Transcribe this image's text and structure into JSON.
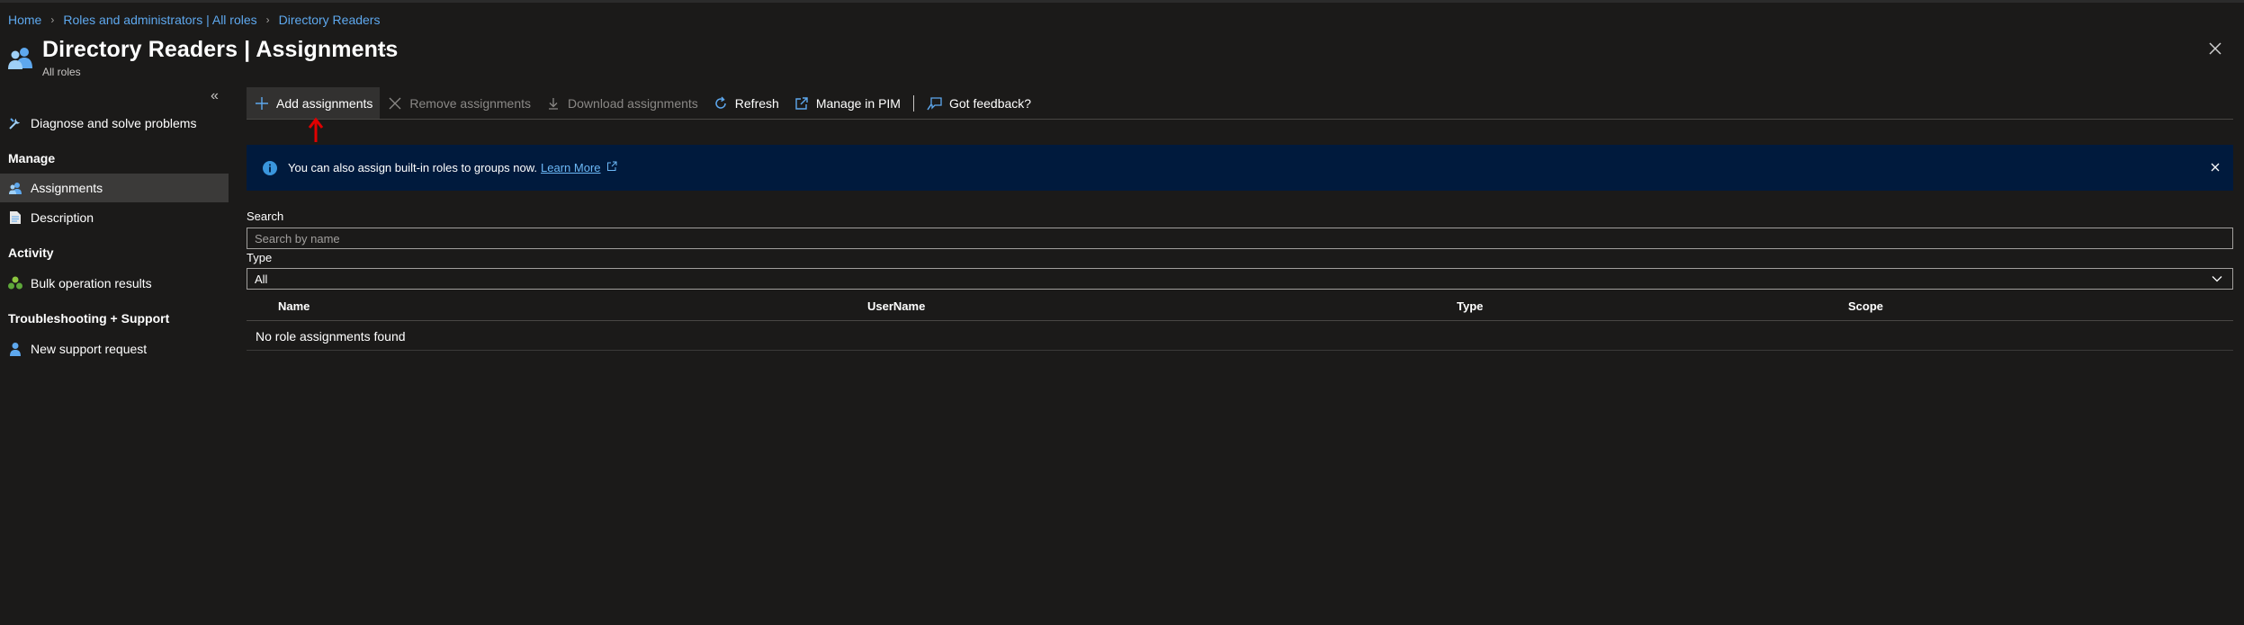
{
  "breadcrumb": [
    {
      "label": "Home"
    },
    {
      "label": "Roles and administrators | All roles"
    },
    {
      "label": "Directory Readers"
    }
  ],
  "header": {
    "title": "Directory Readers | Assignments",
    "subtitle": "All roles",
    "more_label": "···",
    "icon": "users-icon"
  },
  "sidebar": {
    "collapse_label": "«",
    "items": [
      {
        "label": "Diagnose and solve problems",
        "icon": "wrench-icon"
      },
      {
        "section": "Manage"
      },
      {
        "label": "Assignments",
        "icon": "person-icon",
        "active": true
      },
      {
        "label": "Description",
        "icon": "document-icon"
      },
      {
        "section": "Activity"
      },
      {
        "label": "Bulk operation results",
        "icon": "group-icon"
      },
      {
        "section": "Troubleshooting + Support"
      },
      {
        "label": "New support request",
        "icon": "support-person-icon"
      }
    ]
  },
  "toolbar": {
    "add": "Add assignments",
    "remove": "Remove assignments",
    "download": "Download assignments",
    "refresh": "Refresh",
    "manage_pim": "Manage in PIM",
    "feedback": "Got feedback?"
  },
  "info": {
    "text": "You can also assign built-in roles to groups now.",
    "link": "Learn More"
  },
  "filters": {
    "search_label": "Search",
    "search_placeholder": "Search by name",
    "search_value": "",
    "type_label": "Type",
    "type_value": "All"
  },
  "table": {
    "columns": [
      "Name",
      "UserName",
      "Type",
      "Scope"
    ],
    "empty_message": "No role assignments found"
  },
  "colors": {
    "background": "#1b1a19",
    "link": "#5ea8ee",
    "accent": "#0078d4",
    "infobar": "#001a3d",
    "annotation": "#e00000"
  }
}
